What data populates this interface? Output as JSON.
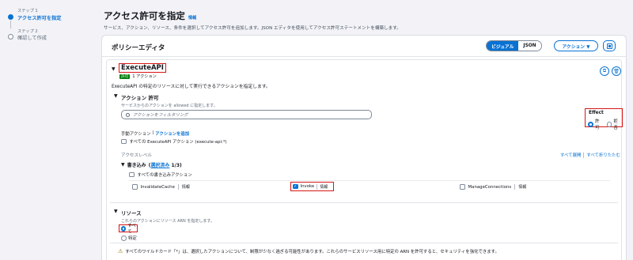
{
  "steps": [
    {
      "number": "ステップ 1",
      "label": "アクセス許可を指定",
      "active": true
    },
    {
      "number": "ステップ 2",
      "label": "確認して作成",
      "active": false
    }
  ],
  "page": {
    "title": "アクセス許可を指定",
    "info": "情報",
    "subtitle": "サービス、アクション、リソース、条件を選択してアクセス許可を追加します。JSON エディタを使用してアクセス許可ステートメントを構築します。"
  },
  "editor": {
    "title": "ポリシーエディタ",
    "toggle_visual": "ビジュアル",
    "toggle_json": "JSON",
    "actions_button": "アクション ▼",
    "service": {
      "name": "ExecuteAPI",
      "badge": "許可",
      "action_count": "1 アクション",
      "description": "ExecuteAPI の特定のリソースに対して実行できるアクションを指定します。"
    },
    "actions_section": {
      "title": "アクション 許可",
      "hint": "サービスからのアクションを allowed に指定します。",
      "filter_placeholder": "アクションをフィルタリング",
      "effect": {
        "title": "Effect",
        "allow": "許可",
        "deny": "拒否"
      },
      "manual_label": "手動アクション",
      "manual_link": "アクションを追加",
      "all_actions": "すべての ExecuteAPI アクション (execute-api:*)",
      "access_level": "アクセスレベル",
      "expand_all": "すべて展開",
      "collapse_all": "すべて折りたたむ",
      "write": {
        "title": "書き込み",
        "selected": "選択済み",
        "count": "1/3",
        "all_write": "すべての書き込みアクション"
      },
      "items": [
        {
          "label": "InvalidateCache",
          "info": "情報",
          "checked": false
        },
        {
          "label": "Invoke",
          "info": "情報",
          "checked": true
        },
        {
          "label": "ManageConnections",
          "info": "情報",
          "checked": false
        }
      ]
    },
    "resources": {
      "title": "リソース",
      "hint": "これらのアクションにリソース ARN を指定します。",
      "all": "すべて",
      "specific": "特定",
      "warning": "すべてのワイルドカード「*」は、選択したアクションについて、制限が少なく過ぎる可能性があります。これらのサービスリソース用に特定の ARN を許可すると、セキュリティを強化できます。"
    }
  }
}
